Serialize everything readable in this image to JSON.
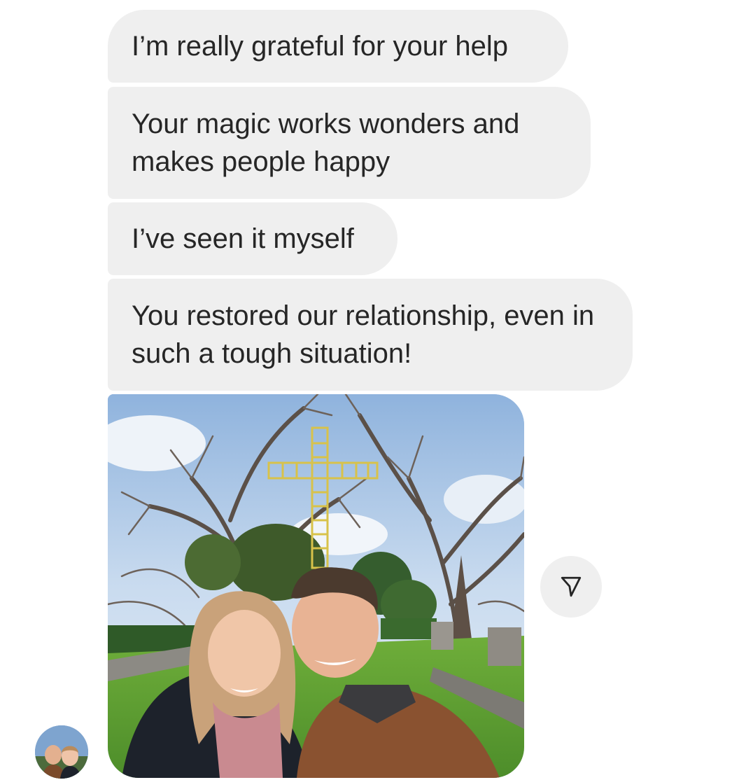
{
  "messages": [
    {
      "text": "I’m really grateful for your help"
    },
    {
      "text": "Your magic works wonders and makes people happy"
    },
    {
      "text": "I’ve seen it myself"
    },
    {
      "text": "You restored our relationship, even in such a tough situation!"
    }
  ],
  "photo": {
    "icon": "couple-selfie-photo"
  },
  "share": {
    "icon": "paper-plane-icon"
  },
  "avatar": {
    "icon": "sender-avatar"
  },
  "colors": {
    "bubble": "#efefef",
    "text": "#262626",
    "background": "#ffffff"
  }
}
